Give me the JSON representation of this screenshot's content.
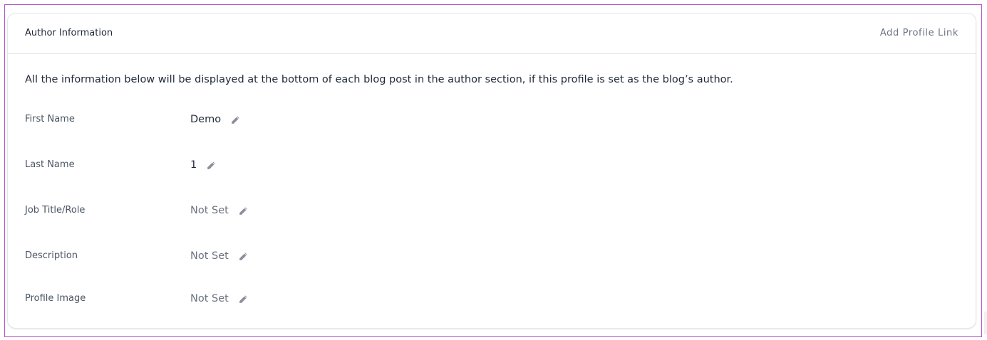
{
  "card": {
    "title": "Author Information",
    "header_link": "Add Profile Link",
    "intro": "All the information below will be displayed at the bottom of each blog post in the author section, if this profile is set as the blog’s author."
  },
  "fields": [
    {
      "label": "First Name",
      "value": "Demo",
      "is_set": true,
      "icon": "pencil-icon"
    },
    {
      "label": "Last Name",
      "value": "1",
      "is_set": true,
      "icon": "pencil-icon"
    },
    {
      "label": "Job Title/Role",
      "value": "Not Set",
      "is_set": false,
      "icon": "pencil-icon"
    },
    {
      "label": "Description",
      "value": "Not Set",
      "is_set": false,
      "icon": "pencil-icon"
    },
    {
      "label": "Profile Image",
      "value": "Not Set",
      "is_set": false,
      "icon": "pencil-icon"
    }
  ],
  "colors": {
    "frame_border": "#b055c6",
    "text_primary": "#1f2937",
    "text_muted": "#6b7280",
    "icon": "#8a8f98"
  }
}
